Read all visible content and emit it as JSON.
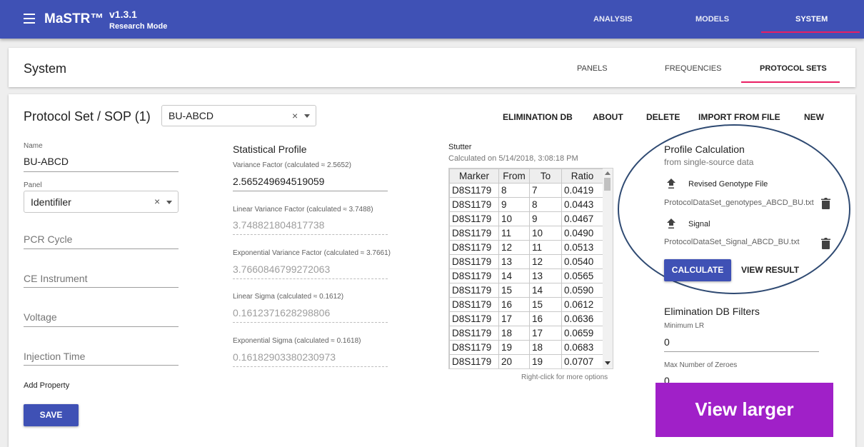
{
  "app": {
    "title": "MaSTR™",
    "version": "v1.3.1",
    "mode": "Research Mode",
    "nav": [
      "ANALYSIS",
      "MODELS",
      "SYSTEM"
    ]
  },
  "system": {
    "title": "System",
    "tabs": [
      "PANELS",
      "FREQUENCIES",
      "PROTOCOL SETS"
    ]
  },
  "protocol_set": {
    "title": "Protocol Set / SOP (1)",
    "selected": "BU-ABCD",
    "actions": [
      "ELIMINATION DB",
      "ABOUT",
      "DELETE",
      "IMPORT FROM FILE",
      "NEW"
    ]
  },
  "form": {
    "name_label": "Name",
    "name_value": "BU-ABCD",
    "panel_label": "Panel",
    "panel_value": "Identifiler",
    "pcr_placeholder": "PCR Cycle",
    "ce_placeholder": "CE Instrument",
    "voltage_placeholder": "Voltage",
    "injection_placeholder": "Injection Time",
    "add_property": "Add Property",
    "save": "SAVE"
  },
  "stat_profile": {
    "title": "Statistical Profile",
    "variance_label": "Variance Factor (calculated ≈ 2.5652)",
    "variance_value": "2.565249694519059",
    "linear_variance_label": "Linear Variance Factor (calculated ≈ 3.7488)",
    "linear_variance_value": "3.748821804817738",
    "exp_variance_label": "Exponential Variance Factor (calculated ≈ 3.7661)",
    "exp_variance_value": "3.7660846799272063",
    "linear_sigma_label": "Linear Sigma (calculated ≈ 0.1612)",
    "linear_sigma_value": "0.1612371628298806",
    "exp_sigma_label": "Exponential Sigma (calculated ≈ 0.1618)",
    "exp_sigma_value": "0.16182903380230973"
  },
  "stutter": {
    "title": "Stutter",
    "calculated_on": "Calculated on 5/14/2018, 3:08:18 PM",
    "headers": [
      "Marker",
      "From",
      "To",
      "Ratio"
    ],
    "rows": [
      [
        "D8S1179",
        "8",
        "7",
        "0.0419"
      ],
      [
        "D8S1179",
        "9",
        "8",
        "0.0443"
      ],
      [
        "D8S1179",
        "10",
        "9",
        "0.0467"
      ],
      [
        "D8S1179",
        "11",
        "10",
        "0.0490"
      ],
      [
        "D8S1179",
        "12",
        "11",
        "0.0513"
      ],
      [
        "D8S1179",
        "13",
        "12",
        "0.0540"
      ],
      [
        "D8S1179",
        "14",
        "13",
        "0.0565"
      ],
      [
        "D8S1179",
        "15",
        "14",
        "0.0590"
      ],
      [
        "D8S1179",
        "16",
        "15",
        "0.0612"
      ],
      [
        "D8S1179",
        "17",
        "16",
        "0.0636"
      ],
      [
        "D8S1179",
        "18",
        "17",
        "0.0659"
      ],
      [
        "D8S1179",
        "19",
        "18",
        "0.0683"
      ],
      [
        "D8S1179",
        "20",
        "19",
        "0.0707"
      ]
    ],
    "hint": "Right-click for more options"
  },
  "profile_calc": {
    "title": "Profile Calculation",
    "subtitle": "from single-source data",
    "genotype_label": "Revised Genotype File",
    "genotype_file": "ProtocolDataSet_genotypes_ABCD_BU.txt",
    "signal_label": "Signal",
    "signal_file": "ProtocolDataSet_Signal_ABCD_BU.txt",
    "calculate": "CALCULATE",
    "view_result": "VIEW RESULT"
  },
  "elim_filters": {
    "title": "Elimination DB Filters",
    "min_lr_label": "Minimum LR",
    "min_lr_value": "0",
    "max_zeroes_label": "Max Number of Zeroes",
    "max_zeroes_value": "0"
  },
  "view_larger": "View larger",
  "colors": {
    "primary": "#3f51b5",
    "accent": "#e91e63",
    "overlay": "#a020c8"
  }
}
